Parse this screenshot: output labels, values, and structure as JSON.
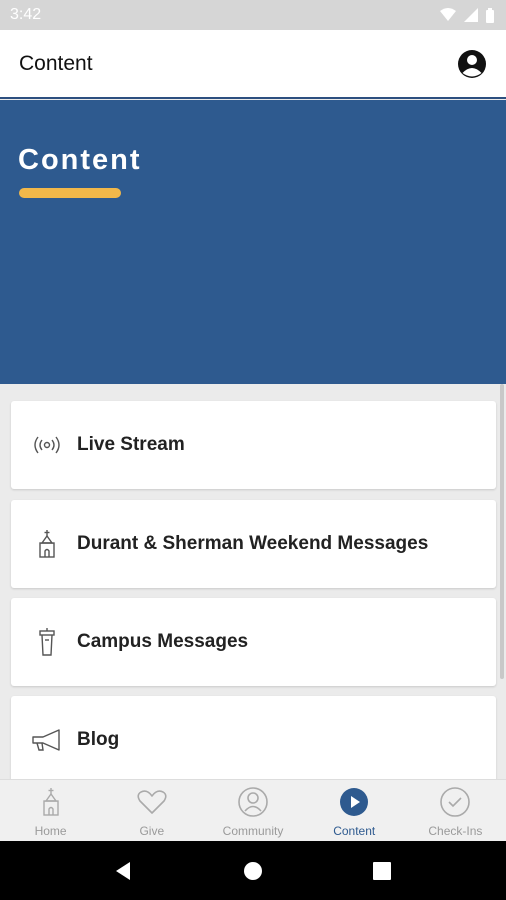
{
  "status_bar": {
    "time": "3:42"
  },
  "app_bar": {
    "title": "Content"
  },
  "hero": {
    "title": "Content",
    "accent_color": "#f2b84a",
    "background": "#2e5a8f"
  },
  "list": [
    {
      "label": "Live Stream",
      "icon": "broadcast-icon"
    },
    {
      "label": "Durant & Sherman Weekend Messages",
      "icon": "church-icon"
    },
    {
      "label": "Campus Messages",
      "icon": "podium-icon"
    },
    {
      "label": "Blog",
      "icon": "megaphone-icon"
    }
  ],
  "bottom_nav": [
    {
      "label": "Home",
      "icon": "church-icon",
      "active": false
    },
    {
      "label": "Give",
      "icon": "heart-icon",
      "active": false
    },
    {
      "label": "Community",
      "icon": "person-icon",
      "active": false
    },
    {
      "label": "Content",
      "icon": "play-icon",
      "active": true
    },
    {
      "label": "Check-Ins",
      "icon": "check-circle-icon",
      "active": false
    }
  ]
}
